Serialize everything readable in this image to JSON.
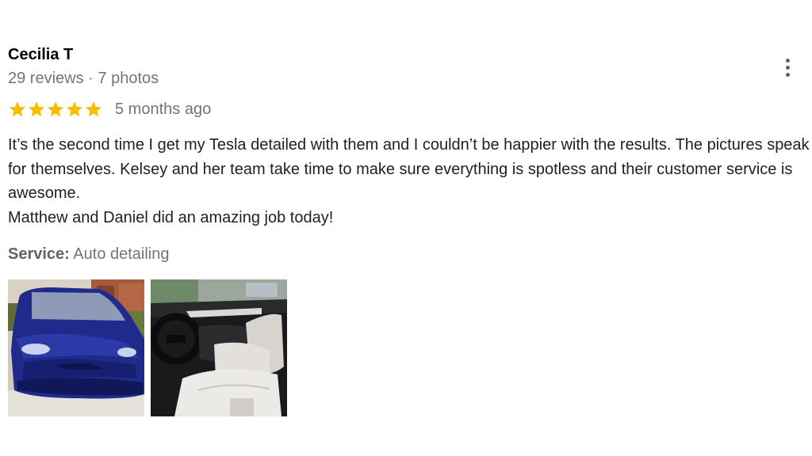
{
  "reviewer": {
    "name": "Cecilia T",
    "reviews": "29 reviews",
    "separator": "·",
    "photos": "7 photos"
  },
  "rating": {
    "stars": 5,
    "star_color": "#fbbc04",
    "date": "5 months ago"
  },
  "review": {
    "paragraph_1": "It’s the second time I get my Tesla detailed with them and I couldn’t be happier with the results. The pictures speak for themselves. Kelsey and her team take time to make sure everything is spotless and their customer service is awesome.",
    "paragraph_2": "Matthew and Daniel did an amazing job today!"
  },
  "service": {
    "label": "Service:",
    "value": "Auto detailing"
  },
  "photos": [
    {
      "name": "car-exterior-photo"
    },
    {
      "name": "car-interior-photo"
    }
  ],
  "icons": {
    "more": "more-vert-icon",
    "star": "star-icon"
  },
  "colors": {
    "name": "#000000",
    "meta": "#70757a",
    "body": "#202124",
    "star": "#fbbc04",
    "car_blue": "#1f2a8a"
  }
}
